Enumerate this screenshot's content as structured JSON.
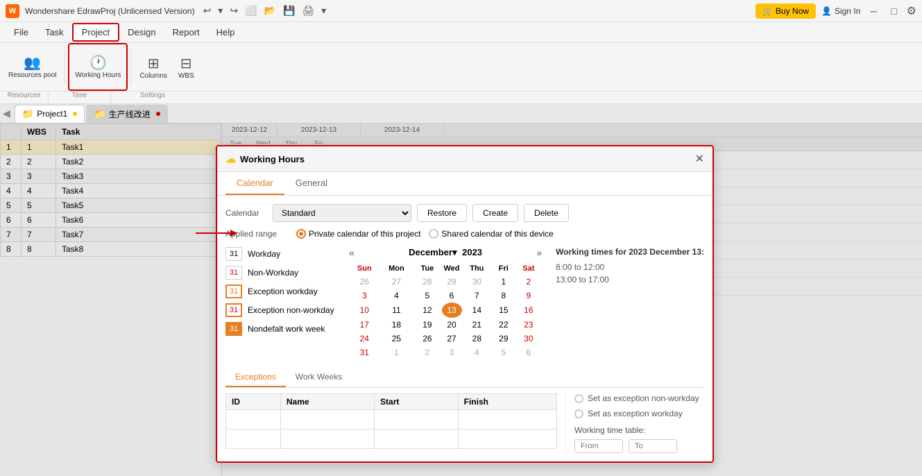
{
  "app": {
    "title": "Wondershare EdrawProj (Unlicensed Version)",
    "logo": "W",
    "buy_label": "Buy Now",
    "sign_label": "Sign In"
  },
  "menu": {
    "items": [
      "File",
      "Task",
      "Project",
      "Design",
      "Report",
      "Help"
    ]
  },
  "toolbar": {
    "resources_pool": "Resources pool",
    "working_hours": "Working Hours",
    "columns": "Columns",
    "wbs": "WBS",
    "sections": {
      "resources": "Resources",
      "time": "Time",
      "settings": "Settings"
    }
  },
  "project_tabs": [
    {
      "label": "Project1",
      "dot": "yellow"
    },
    {
      "label": "生产线改进",
      "dot": "red"
    }
  ],
  "task_table": {
    "headers": [
      "WBS",
      "Task"
    ],
    "rows": [
      {
        "id": 1,
        "wbs": 1,
        "task": "Task1",
        "highlight": true
      },
      {
        "id": 2,
        "wbs": 2,
        "task": "Task2"
      },
      {
        "id": 3,
        "wbs": 3,
        "task": "Task3"
      },
      {
        "id": 4,
        "wbs": 4,
        "task": "Task4"
      },
      {
        "id": 5,
        "wbs": 5,
        "task": "Task5"
      },
      {
        "id": 6,
        "wbs": 6,
        "task": "Task6"
      },
      {
        "id": 7,
        "wbs": 7,
        "task": "Task7"
      },
      {
        "id": 8,
        "wbs": 8,
        "task": "Task8"
      }
    ]
  },
  "gantt": {
    "date_rows": {
      "top": [
        "2023-12-12",
        "2023-12-13",
        "2023-12-14"
      ],
      "top_widths": [
        80,
        120,
        120
      ]
    }
  },
  "modal": {
    "title": "Working Hours",
    "title_icon": "☁",
    "tabs": [
      "Calendar",
      "General"
    ],
    "active_tab": "Calendar",
    "calendar_label": "Calendar",
    "calendar_value": "Standard",
    "restore_label": "Restore",
    "create_label": "Create",
    "delete_label": "Delete",
    "applied_range_label": "Applied range",
    "radio_options": [
      "Private calendar of this project",
      "Shared calendar of this device"
    ],
    "active_radio": 0,
    "legend": [
      {
        "num": "31",
        "label": "Workday",
        "style": "normal"
      },
      {
        "num": "31",
        "label": "Non-Workday",
        "style": "red"
      },
      {
        "num": "31",
        "label": "Exception workday",
        "style": "orange-border"
      },
      {
        "num": "31",
        "label": "Exception non-workday",
        "style": "orange-border-red"
      },
      {
        "num": "31",
        "label": "Nondefalt work week",
        "style": "orange-bg"
      }
    ],
    "calendar": {
      "month": "December",
      "year": "2023",
      "days_header": [
        "Sun",
        "Mon",
        "Tue",
        "Wed",
        "Thu",
        "Fri",
        "Sat"
      ],
      "weeks": [
        [
          "26",
          "27",
          "28",
          "29",
          "30",
          "1",
          "2"
        ],
        [
          "3",
          "4",
          "5",
          "6",
          "7",
          "8",
          "9"
        ],
        [
          "10",
          "11",
          "12",
          "13",
          "14",
          "15",
          "16"
        ],
        [
          "17",
          "18",
          "19",
          "20",
          "21",
          "22",
          "23"
        ],
        [
          "24",
          "25",
          "26",
          "27",
          "28",
          "29",
          "30"
        ],
        [
          "31",
          "1",
          "2",
          "3",
          "4",
          "5",
          "6"
        ]
      ],
      "other_month_days": [
        "26",
        "27",
        "28",
        "29",
        "30",
        "1",
        "2",
        "9",
        "16",
        "23",
        "30",
        "31",
        "1",
        "2",
        "3",
        "4",
        "5",
        "6"
      ],
      "selected_day": "13",
      "sun_days": [
        0
      ],
      "sat_days": [
        6
      ]
    },
    "working_times_title": "Working times for 2023 December 13:",
    "working_times": [
      "8:00 to 12:00",
      "13:00 to 17:00"
    ],
    "exceptions_tabs": [
      "Exceptions",
      "Work Weeks"
    ],
    "active_exc_tab": "Exceptions",
    "exc_table_headers": [
      "ID",
      "Name",
      "Start",
      "Finish"
    ],
    "right_panel": {
      "option1": "Set as exception non-workday",
      "option2": "Set as exception workday",
      "working_time_table": "Working time table:",
      "from_label": "From",
      "to_label": "To"
    }
  },
  "colors": {
    "accent": "#e67e22",
    "red": "#cc0000",
    "blue": "#5b9bd5",
    "yellow": "#ffc107"
  }
}
